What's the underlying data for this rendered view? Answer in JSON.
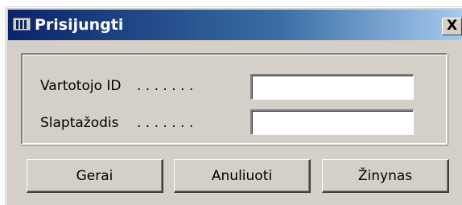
{
  "window": {
    "title": "Prisijungti",
    "close_label": "X"
  },
  "form": {
    "user_id": {
      "label": "Vartotojo ID",
      "leader": ". . . . . . .",
      "value": ""
    },
    "password": {
      "label": "Slaptažodis",
      "leader": ". . . . . . .",
      "value": ""
    }
  },
  "buttons": {
    "ok_label": "Gerai",
    "cancel_label": "Anuliuoti",
    "help_label": "Žinynas"
  },
  "colors": {
    "titlebar_start": "#0a246a",
    "titlebar_end": "#a6caf0",
    "dialog_face": "#d4d0c8"
  },
  "icons": {
    "app_icon": "window-app-icon",
    "close_icon": "close-icon"
  }
}
